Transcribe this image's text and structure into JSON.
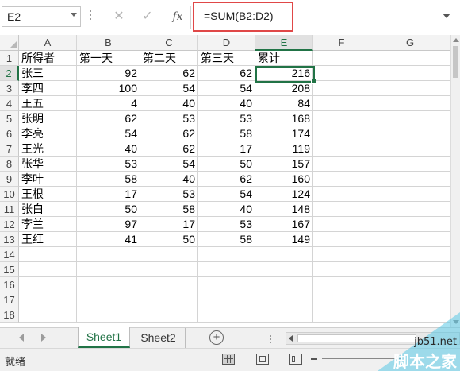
{
  "name_box": {
    "value": "E2"
  },
  "formula_bar": {
    "cancel_icon": "close-icon",
    "enter_icon": "check-icon",
    "function_label": "fx",
    "formula": "=SUM(B2:D2)"
  },
  "columns": [
    "A",
    "B",
    "C",
    "D",
    "E",
    "F",
    "G"
  ],
  "rows": [
    "1",
    "2",
    "3",
    "4",
    "5",
    "6",
    "7",
    "8",
    "9",
    "10",
    "11",
    "12",
    "13",
    "14",
    "15",
    "16",
    "17",
    "18"
  ],
  "selected_cell": "E2",
  "sheet": {
    "headers": [
      "所得者",
      "第一天",
      "第二天",
      "第三天",
      "累计"
    ],
    "data": [
      [
        "张三",
        "92",
        "62",
        "62",
        "216"
      ],
      [
        "李四",
        "100",
        "54",
        "54",
        "208"
      ],
      [
        "王五",
        "4",
        "40",
        "40",
        "84"
      ],
      [
        "张明",
        "62",
        "53",
        "53",
        "168"
      ],
      [
        "李亮",
        "54",
        "62",
        "58",
        "174"
      ],
      [
        "王光",
        "40",
        "62",
        "17",
        "119"
      ],
      [
        "张华",
        "53",
        "54",
        "50",
        "157"
      ],
      [
        "李叶",
        "58",
        "40",
        "62",
        "160"
      ],
      [
        "王根",
        "17",
        "53",
        "54",
        "124"
      ],
      [
        "张白",
        "50",
        "58",
        "40",
        "148"
      ],
      [
        "李兰",
        "97",
        "17",
        "53",
        "167"
      ],
      [
        "王红",
        "41",
        "50",
        "58",
        "149"
      ]
    ]
  },
  "tabs": [
    {
      "label": "Sheet1",
      "active": true
    },
    {
      "label": "Sheet2",
      "active": false
    }
  ],
  "add_sheet_icon": "plus-circle-icon",
  "status": {
    "text": "就绪"
  },
  "watermark": {
    "url": "jb51.net",
    "name": "脚本之家"
  },
  "colors": {
    "accent": "#217346",
    "highlight": "#e04848"
  }
}
